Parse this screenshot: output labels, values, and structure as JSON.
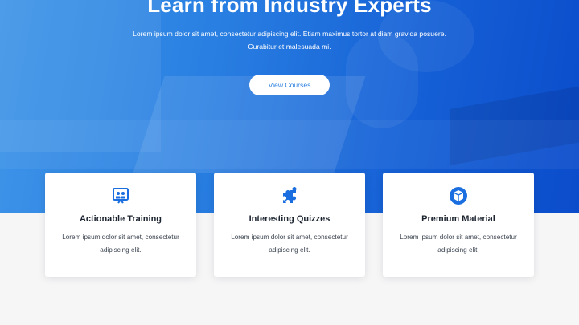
{
  "hero": {
    "title": "Learn from Industry Experts",
    "description": "Lorem ipsum dolor sit amet, consectetur adipiscing elit. Etiam maximus tortor at diam gravida posuere. Curabitur et malesuada mi.",
    "cta_label": "View Courses",
    "accent_color": "#1a6ee0"
  },
  "features": [
    {
      "icon": "presentation-icon",
      "title": "Actionable Training",
      "text": "Lorem ipsum dolor sit amet, consectetur adipiscing elit."
    },
    {
      "icon": "puzzle-icon",
      "title": "Interesting Quizzes",
      "text": "Lorem ipsum dolor sit amet, consectetur adipiscing elit."
    },
    {
      "icon": "cube-icon",
      "title": "Premium Material",
      "text": "Lorem ipsum dolor sit amet, consectetur adipiscing elit."
    }
  ]
}
